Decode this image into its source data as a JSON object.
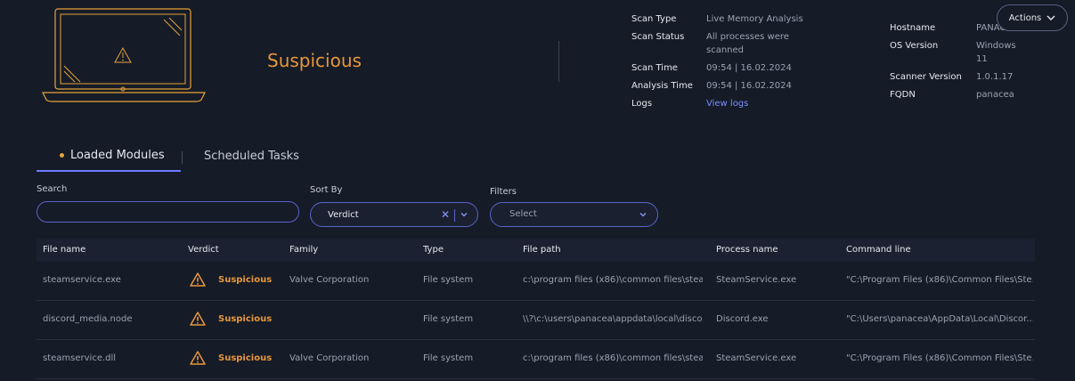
{
  "header": {
    "verdict": "Suspicious",
    "scan": [
      {
        "label": "Scan Type",
        "value": "Live Memory Analysis"
      },
      {
        "label": "Scan Status",
        "value": "All processes were scanned"
      },
      {
        "label": "Scan Time",
        "value": "09:54 | 16.02.2024"
      },
      {
        "label": "Analysis Time",
        "value": "09:54 | 16.02.2024"
      },
      {
        "label": "Logs",
        "value": "View logs"
      }
    ],
    "host": [
      {
        "label": "Hostname",
        "value": "PANAC"
      },
      {
        "label": "OS Version",
        "value": "Windows 11"
      },
      {
        "label": "Scanner Version",
        "value": "1.0.1.17"
      },
      {
        "label": "FQDN",
        "value": "panacea"
      }
    ],
    "actions_label": "Actions"
  },
  "tabs": [
    {
      "label": "Loaded Modules",
      "active": true
    },
    {
      "label": "Scheduled Tasks",
      "active": false
    }
  ],
  "controls": {
    "search_label": "Search",
    "search_value": "",
    "sort_label": "Sort By",
    "sort_value": "Verdict",
    "filters_label": "Filters",
    "filters_placeholder": "Select"
  },
  "table": {
    "columns": [
      "File name",
      "Verdict",
      "Family",
      "Type",
      "File path",
      "Process name",
      "Command line"
    ],
    "rows": [
      {
        "file_name": "steamservice.exe",
        "verdict": "Suspicious",
        "family": "Valve Corporation",
        "type": "File system",
        "file_path": "c:\\program files (x86)\\common files\\stea...",
        "process_name": "SteamService.exe",
        "command_line": "\"C:\\Program Files (x86)\\Common Files\\Ste..."
      },
      {
        "file_name": "discord_media.node",
        "verdict": "Suspicious",
        "family": "",
        "type": "File system",
        "file_path": "\\\\?\\c:\\users\\panacea\\appdata\\local\\disco...",
        "process_name": "Discord.exe",
        "command_line": "\"C:\\Users\\panacea\\AppData\\Local\\Discor..."
      },
      {
        "file_name": "steamservice.dll",
        "verdict": "Suspicious",
        "family": "Valve Corporation",
        "type": "File system",
        "file_path": "c:\\program files (x86)\\common files\\stea...",
        "process_name": "SteamService.exe",
        "command_line": "\"C:\\Program Files (x86)\\Common Files\\Ste..."
      }
    ]
  },
  "colors": {
    "accent": "#6c7cff",
    "warning": "#e8973a",
    "background": "#151b27"
  }
}
